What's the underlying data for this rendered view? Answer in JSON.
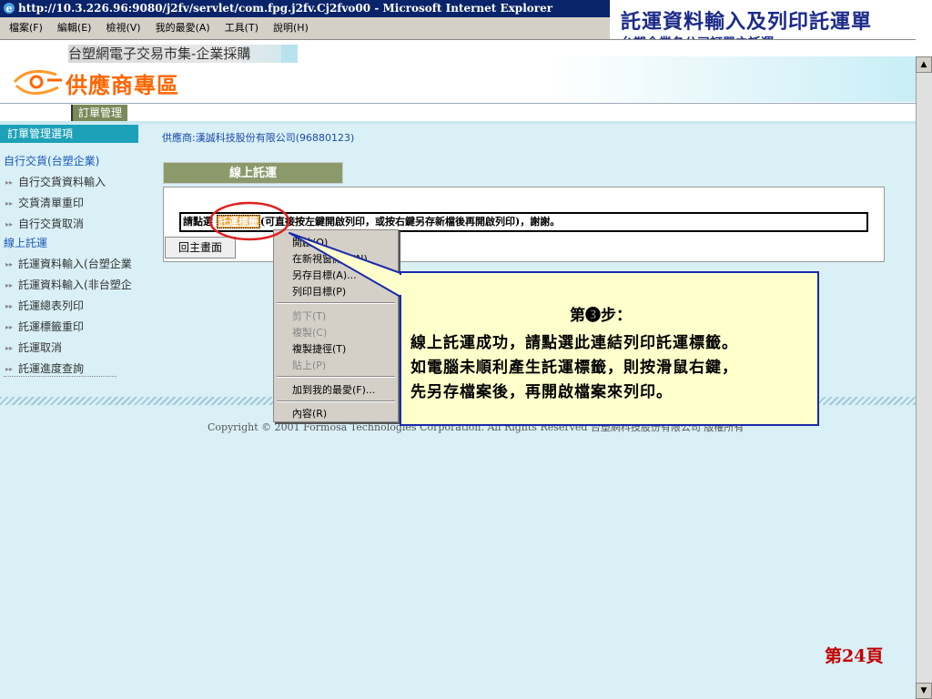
{
  "window": {
    "title": "http://10.3.226.96:9080/j2fv/servlet/com.fpg.j2fv.Cj2fvo00 - Microsoft Internet Explorer"
  },
  "menubar": [
    "檔案(F)",
    "編輯(E)",
    "檢視(V)",
    "我的最愛(A)",
    "工具(T)",
    "說明(H)"
  ],
  "slide": {
    "title": "託運資料輸入及列印託運單",
    "subtitle": "台塑企業各公司訂單之託運",
    "page": "第24頁"
  },
  "header": {
    "market": "台塑網電子交易市集-企業採購",
    "zone": "供應商專區",
    "tab": "訂單管理"
  },
  "sidebar": {
    "header": "訂單管理選項",
    "cat1": "自行交貨(台塑企業)",
    "cat1_items": [
      "自行交貨資料輸入",
      "交貨清單重印",
      "自行交貨取消"
    ],
    "cat2": "線上託運",
    "cat2_items": [
      "託運資料輸入(台塑企業",
      "託運資料輸入(非台塑企",
      "託運總表列印",
      "託運標籤重印",
      "託運取消",
      "託運進度查詢"
    ]
  },
  "main": {
    "supplier": "供應商:漢誠科技股份有限公司(96880123)",
    "section_tab": "線上託運",
    "msg_prefix": "請點選",
    "msg_link": "託運標籤",
    "msg_suffix": "(可直接按左鍵開啟列印，或按右鍵另存新檔後再開啟列印)，謝謝。",
    "home_button": "回主畫面"
  },
  "context_menu": {
    "open": "開啟(O)",
    "open_new": "在新視窗開啟(N)",
    "save_as": "另存目標(A)...",
    "print_target": "列印目標(P)",
    "cut": "剪下(T)",
    "copy": "複製(C)",
    "copy_shortcut": "複製捷徑(T)",
    "paste": "貼上(P)",
    "add_fav": "加到我的最愛(F)...",
    "properties": "內容(R)"
  },
  "footer": {
    "copyright": "Copyright © 2001 Formosa Technologies Corporation. All Rights Reserved 台塑網科技股份有限公司 版權所有"
  },
  "callout": {
    "step": "第❸步：",
    "line1": "線上託運成功，請點選此連結列印託運標籤。",
    "line2": "如電腦未順利產生託運標籤，則按滑鼠右鍵，",
    "line3": "先另存檔案後，再開啟檔案來列印。"
  }
}
